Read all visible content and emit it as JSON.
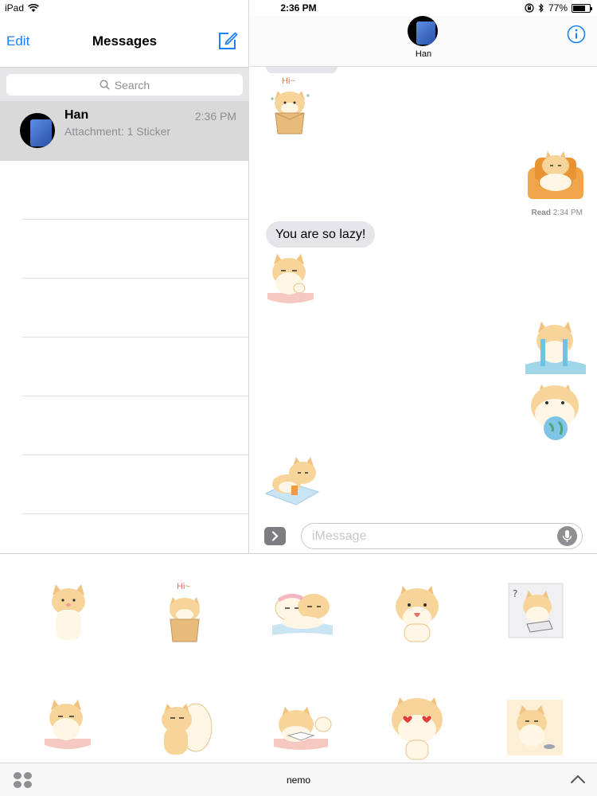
{
  "status_bar": {
    "device": "iPad",
    "time": "2:36 PM",
    "battery": "77%",
    "battery_level": 0.77,
    "icons": [
      "wifi-icon",
      "lock-rotation-icon",
      "bluetooth-icon",
      "battery-icon"
    ]
  },
  "conversation_list": {
    "edit_label": "Edit",
    "title": "Messages",
    "compose_icon": "compose-icon",
    "search_placeholder": "Search",
    "conversations": [
      {
        "name": "Han",
        "time": "2:36 PM",
        "preview": "Attachment: 1 Sticker"
      }
    ]
  },
  "chat": {
    "contact_name": "Han",
    "info_icon": "info-icon",
    "hi_text": "Hi~",
    "read_label": "Read",
    "read_time": "2:34 PM",
    "bubble_text": "You are so lazy!",
    "input_placeholder": "iMessage",
    "stickers": [
      {
        "from": "received",
        "depicts": "cat waving from a box with Hi~"
      },
      {
        "from": "sent",
        "depicts": "cat lounging in an orange armchair"
      },
      {
        "from": "received",
        "depicts": "bored cat with chin on paw"
      },
      {
        "from": "sent",
        "depicts": "cat crying a puddle"
      },
      {
        "from": "sent",
        "depicts": "cat hugging a blue globe"
      },
      {
        "from": "received",
        "depicts": "cat lying on a blanket with a drink"
      }
    ]
  },
  "sticker_drawer": {
    "pack_name": "nemo",
    "apps_icon": "app-drawer-icon",
    "collapse_icon": "chevron-up-icon",
    "hi_text": "Hi~",
    "sticker_names": [
      "cat-standing",
      "cat-box-hi",
      "cats-sleeping",
      "cat-tongue",
      "cat-thinking-pizza",
      "cat-chin-paw",
      "cats-hugging",
      "cat-reading",
      "cat-heart-eyes",
      "cat-tea"
    ]
  },
  "colors": {
    "accent": "#1a82fb",
    "bubble_gray": "#e5e5ea",
    "fur": "#f7d59a",
    "cream": "#fff6e6",
    "selected_row": "#d9d9d9"
  }
}
